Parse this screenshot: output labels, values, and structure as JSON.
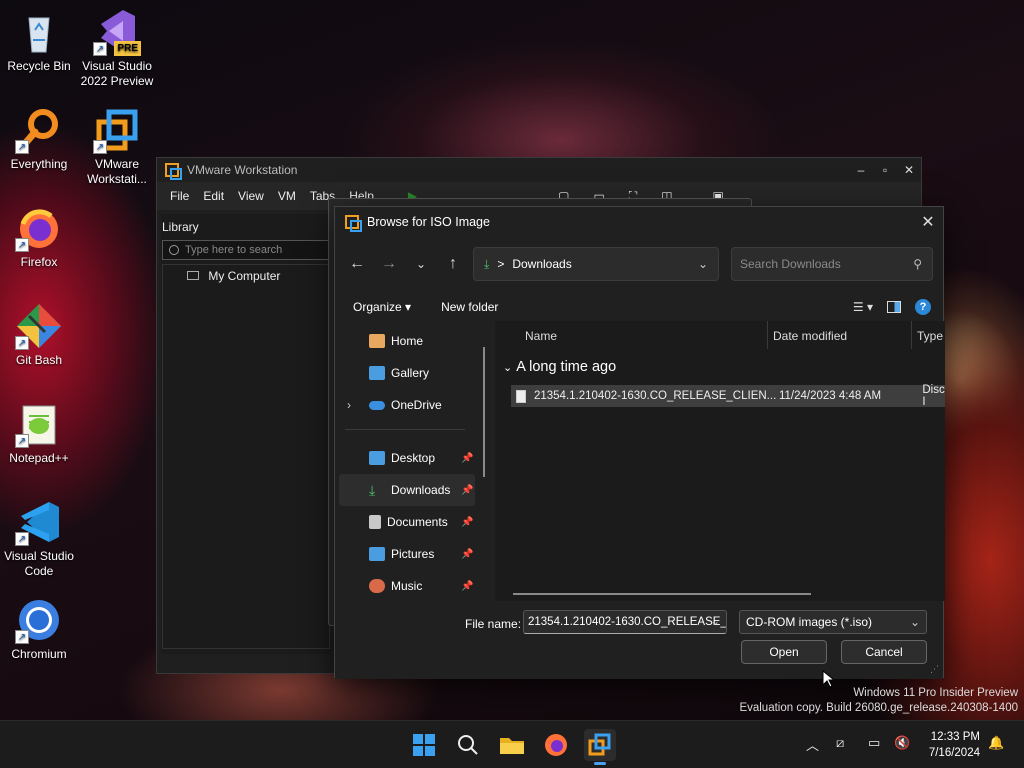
{
  "desktop": {
    "icons": [
      {
        "label": "Recycle Bin",
        "icon": "recycle-bin-icon"
      },
      {
        "label": "Visual Studio 2022 Preview",
        "icon": "visual-studio-icon",
        "badge": "PRE"
      },
      {
        "label": "Everything",
        "icon": "everything-search-icon"
      },
      {
        "label": "VMware Workstati...",
        "icon": "vmware-icon"
      },
      {
        "label": "Firefox",
        "icon": "firefox-icon"
      },
      {
        "label": "Git Bash",
        "icon": "git-bash-icon"
      },
      {
        "label": "Notepad++",
        "icon": "notepad-plus-plus-icon"
      },
      {
        "label": "Visual Studio Code",
        "icon": "vscode-icon"
      },
      {
        "label": "Chromium",
        "icon": "chromium-icon"
      }
    ]
  },
  "vmware": {
    "title": "VMware Workstation",
    "menu": [
      "File",
      "Edit",
      "View",
      "VM",
      "Tabs",
      "Help"
    ],
    "library": {
      "header": "Library",
      "search_placeholder": "Type here to search",
      "tree_item": "My Computer"
    }
  },
  "dialog": {
    "title": "Browse for ISO Image",
    "address": {
      "folder": "Downloads",
      "separator": ">"
    },
    "search_placeholder": "Search Downloads",
    "commands": {
      "organize": "Organize",
      "new_folder": "New folder"
    },
    "nav": [
      {
        "label": "Home",
        "icon": "home-icon",
        "color": "#e8a860"
      },
      {
        "label": "Gallery",
        "icon": "gallery-icon",
        "color": "#4a9de0"
      },
      {
        "label": "OneDrive",
        "icon": "onedrive-icon",
        "color": "#3b8fe0"
      },
      {
        "label": "Desktop",
        "icon": "desktop-folder-icon",
        "color": "#4a9de0"
      },
      {
        "label": "Downloads",
        "icon": "downloads-folder-icon",
        "color": "#4ec06c"
      },
      {
        "label": "Documents",
        "icon": "documents-folder-icon",
        "color": "#c8c8c8"
      },
      {
        "label": "Pictures",
        "icon": "pictures-folder-icon",
        "color": "#4a9de0"
      },
      {
        "label": "Music",
        "icon": "music-folder-icon",
        "color": "#d86a4a"
      }
    ],
    "columns": {
      "name": "Name",
      "date": "Date modified",
      "type": "Type"
    },
    "group": "A long time ago",
    "files": [
      {
        "name": "21354.1.210402-1630.CO_RELEASE_CLIEN...",
        "date": "11/24/2023 4:48 AM",
        "type": "Disc I"
      }
    ],
    "file_name_label": "File name:",
    "file_name_value": "21354.1.210402-1630.CO_RELEASE_",
    "file_type": "CD-ROM images (*.iso)",
    "open_label": "Open",
    "cancel_label": "Cancel"
  },
  "watermark": {
    "line1": "Windows 11 Pro Insider Preview",
    "line2": "Evaluation copy. Build 26080.ge_release.240308-1400"
  },
  "taskbar": {
    "apps": [
      "start-icon",
      "search-icon",
      "file-explorer-icon",
      "firefox-icon",
      "vmware-icon"
    ],
    "time": "12:33 PM",
    "date": "7/16/2024"
  }
}
